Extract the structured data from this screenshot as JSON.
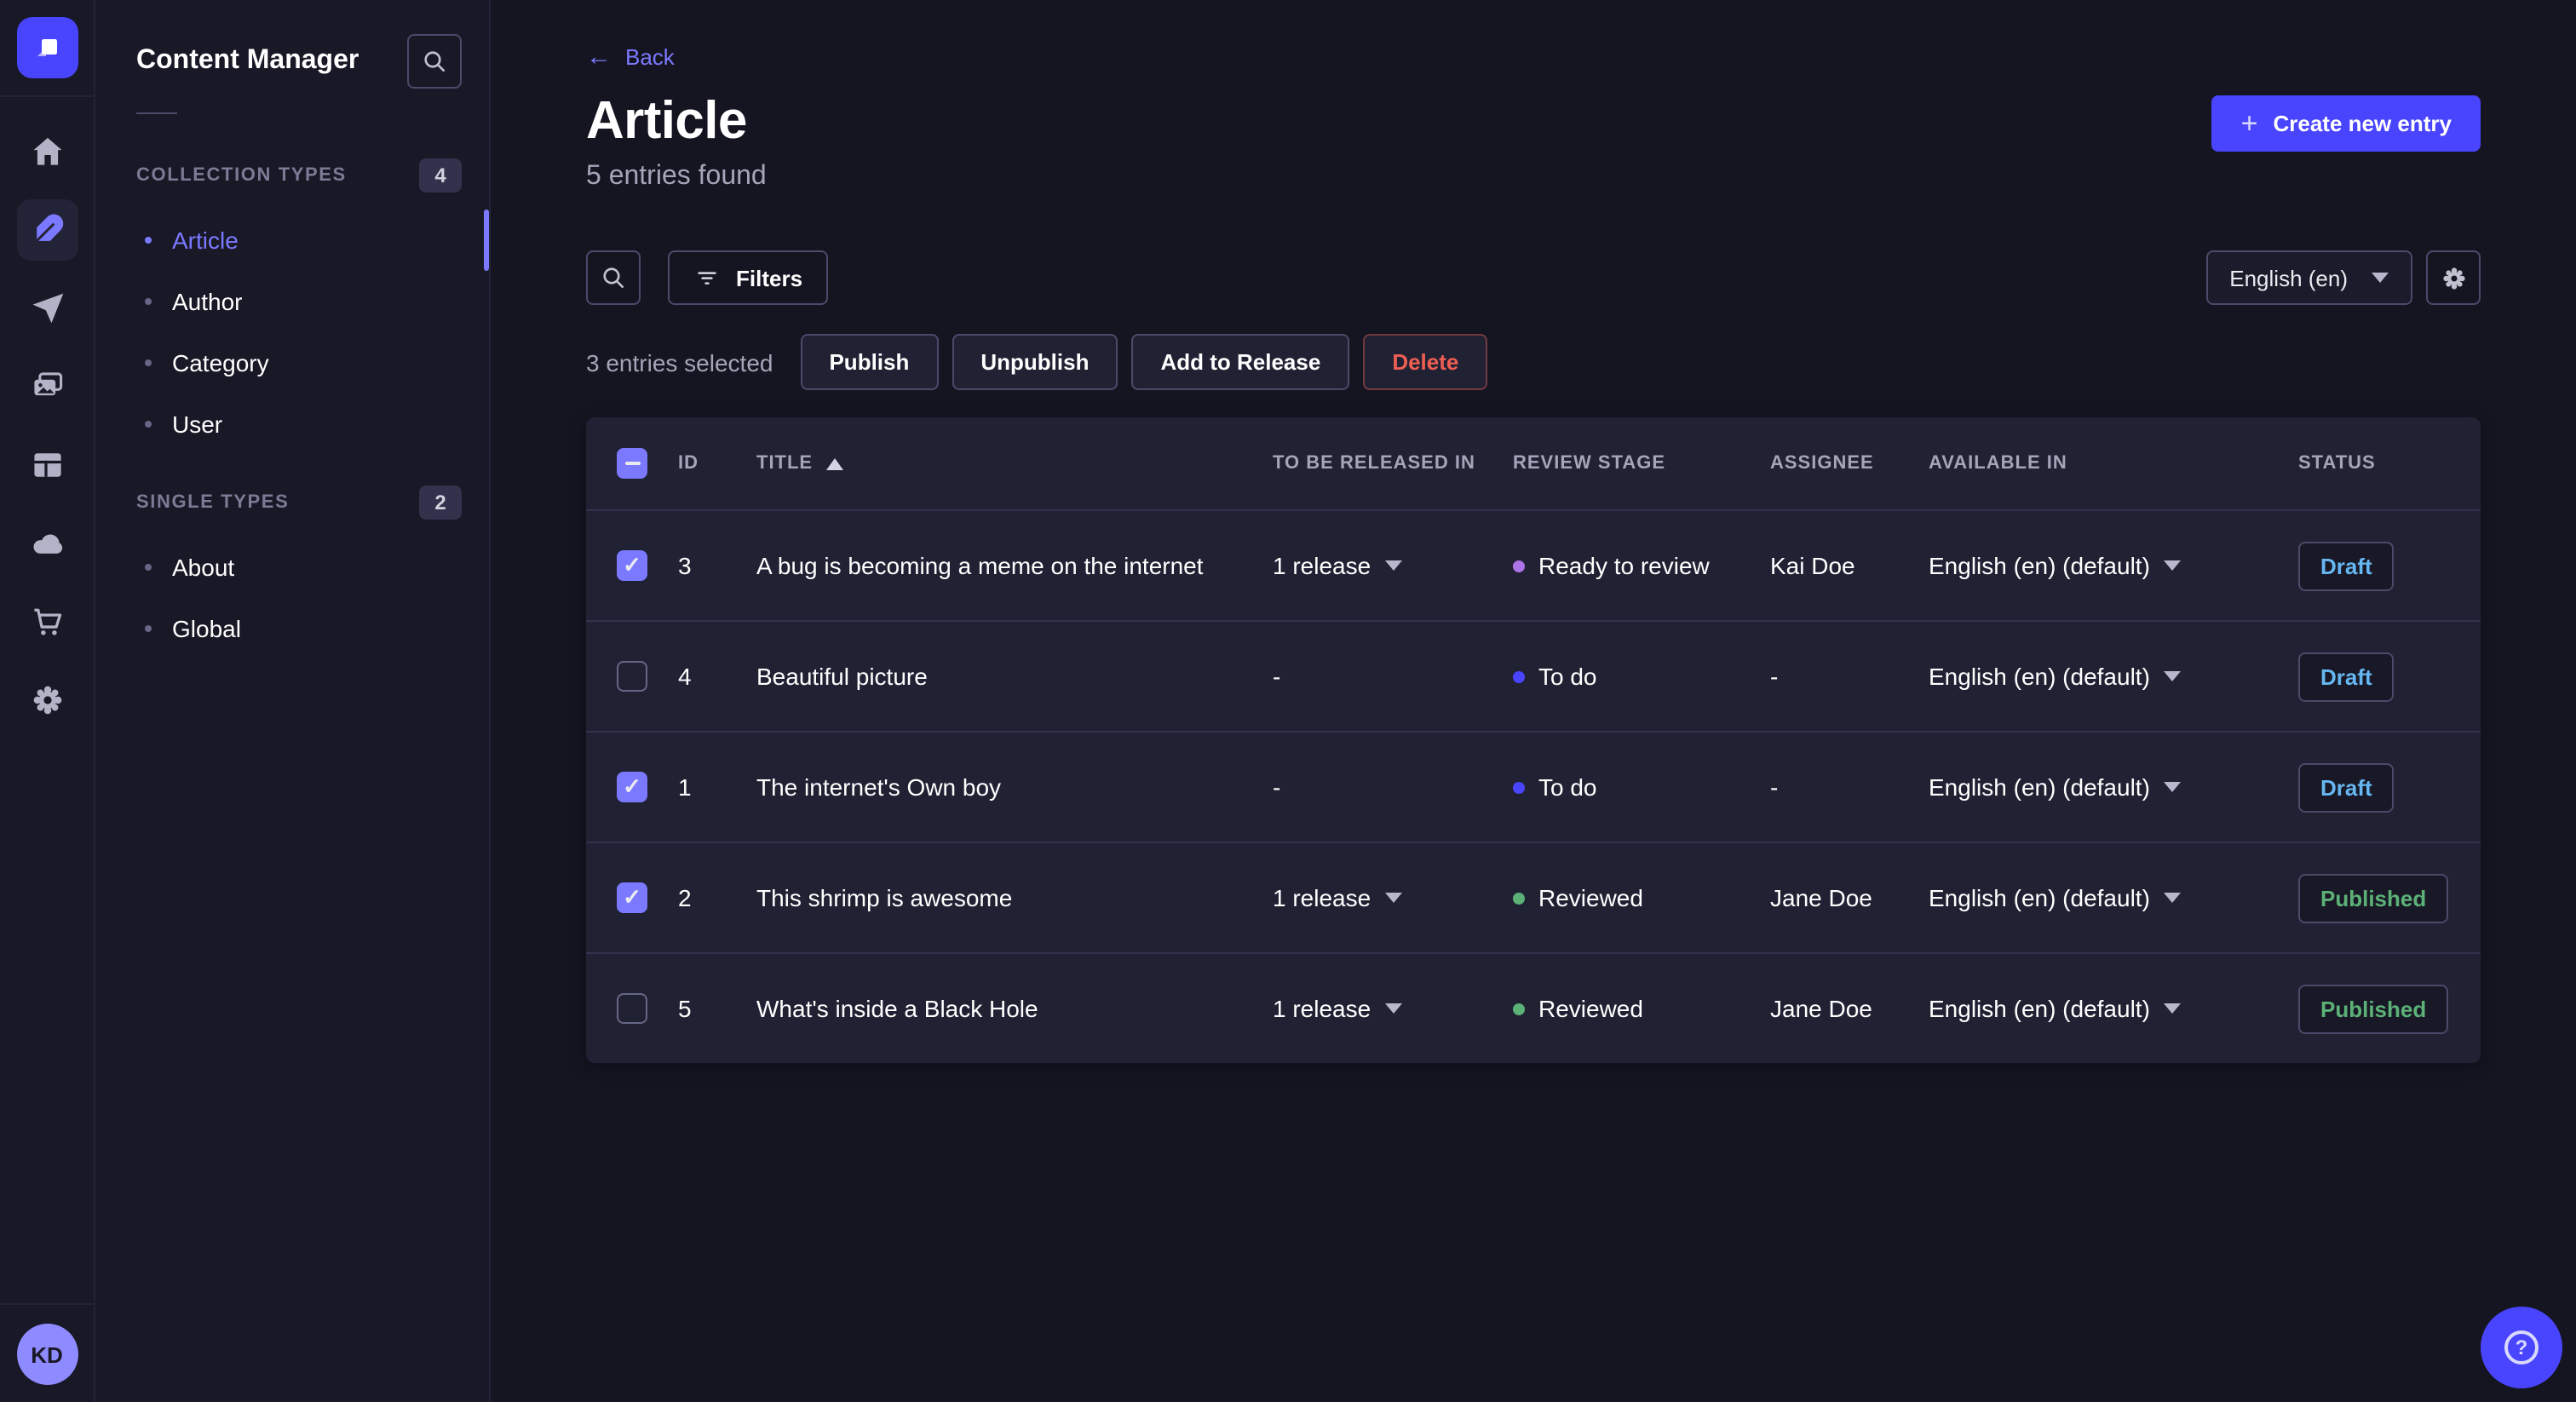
{
  "colors": {
    "primary": "#4945ff",
    "primary_light": "#7b79ff",
    "draft_text": "#66b7f1",
    "published_text": "#5cb176",
    "danger_text": "#ee5e52",
    "stage_ready": "#ac73e6",
    "stage_todo": "#4945ff",
    "stage_reviewed": "#5cb176"
  },
  "rail": {
    "avatar_initials": "KD",
    "icons": [
      "home",
      "content-manager",
      "releases",
      "media-library",
      "content-type-builder",
      "deploy",
      "marketplace",
      "settings"
    ]
  },
  "subnav": {
    "title": "Content Manager",
    "sections": [
      {
        "label": "COLLECTION TYPES",
        "badge": "4",
        "items": [
          {
            "label": "Article"
          },
          {
            "label": "Author"
          },
          {
            "label": "Category"
          },
          {
            "label": "User"
          }
        ]
      },
      {
        "label": "SINGLE TYPES",
        "badge": "2",
        "items": [
          {
            "label": "About"
          },
          {
            "label": "Global"
          }
        ]
      }
    ]
  },
  "header": {
    "back_label": "Back",
    "title": "Article",
    "subtitle": "5 entries found",
    "create_label": "Create new entry"
  },
  "toolbar": {
    "filters_label": "Filters",
    "locale_value": "English (en)"
  },
  "selection": {
    "text": "3 entries selected",
    "publish_label": "Publish",
    "unpublish_label": "Unpublish",
    "add_to_release_label": "Add to Release",
    "delete_label": "Delete"
  },
  "table": {
    "headers": [
      "ID",
      "TITLE",
      "TO BE RELEASED IN",
      "REVIEW STAGE",
      "ASSIGNEE",
      "AVAILABLE IN",
      "STATUS"
    ],
    "rows": [
      {
        "checked": true,
        "id": "3",
        "title": "A bug is becoming a meme on the internet",
        "release": "1 release",
        "stage": "Ready to review",
        "stage_color": "#ac73e6",
        "assignee": "Kai Doe",
        "available": "English (en) (default)",
        "status": "Draft",
        "status_color": "#66b7f1"
      },
      {
        "checked": false,
        "id": "4",
        "title": "Beautiful picture",
        "release": "-",
        "stage": "To do",
        "stage_color": "#4945ff",
        "assignee": "-",
        "available": "English (en) (default)",
        "status": "Draft",
        "status_color": "#66b7f1"
      },
      {
        "checked": true,
        "id": "1",
        "title": "The internet's Own boy",
        "release": "-",
        "stage": "To do",
        "stage_color": "#4945ff",
        "assignee": "-",
        "available": "English (en) (default)",
        "status": "Draft",
        "status_color": "#66b7f1"
      },
      {
        "checked": true,
        "id": "2",
        "title": "This shrimp is awesome",
        "release": "1 release",
        "stage": "Reviewed",
        "stage_color": "#5cb176",
        "assignee": "Jane Doe",
        "available": "English (en) (default)",
        "status": "Published",
        "status_color": "#5cb176"
      },
      {
        "checked": false,
        "id": "5",
        "title": "What's inside a Black Hole",
        "release": "1 release",
        "stage": "Reviewed",
        "stage_color": "#5cb176",
        "assignee": "Jane Doe",
        "available": "English (en) (default)",
        "status": "Published",
        "status_color": "#5cb176"
      }
    ]
  },
  "fab": {
    "help": "?"
  }
}
